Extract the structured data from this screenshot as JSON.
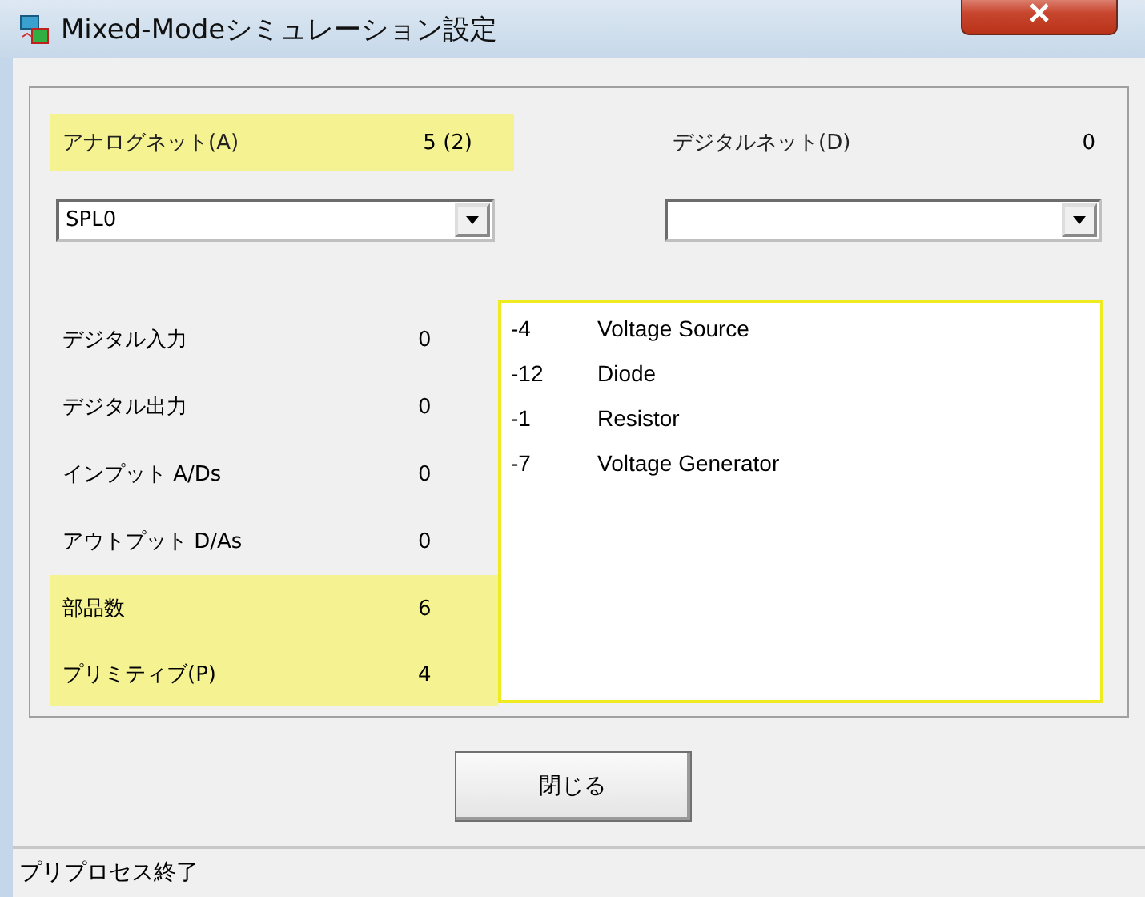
{
  "window": {
    "title": "Mixed-Modeシミュレーション設定"
  },
  "analog_net": {
    "label": "アナログネット(A)",
    "value": "5 (2)",
    "highlighted": true
  },
  "digital_net": {
    "label": "デジタルネット(D)",
    "value": "0",
    "highlighted": false
  },
  "analog_combo": {
    "value": "SPL0"
  },
  "stats": [
    {
      "label": "デジタル入力",
      "value": "0",
      "highlighted": false
    },
    {
      "label": "デジタル出力",
      "value": "0",
      "highlighted": false
    },
    {
      "label": "インプット A/Ds",
      "value": "0",
      "highlighted": false
    },
    {
      "label": "アウトプット D/As",
      "value": "0",
      "highlighted": false
    },
    {
      "label": "部品数",
      "value": "6",
      "highlighted": true
    },
    {
      "label": "プリミティブ(P)",
      "value": "4",
      "highlighted": true
    }
  ],
  "parts_list": [
    {
      "number": "-4",
      "name": "Voltage Source"
    },
    {
      "number": "-12",
      "name": "Diode"
    },
    {
      "number": "-1",
      "name": "Resistor"
    },
    {
      "number": "-7",
      "name": "Voltage Generator"
    }
  ],
  "buttons": [
    "閉じる"
  ],
  "status_bar": "プリプロセス終了"
}
